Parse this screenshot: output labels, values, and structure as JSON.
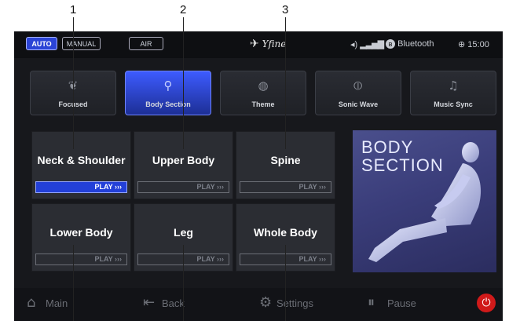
{
  "callouts": [
    "1",
    "2",
    "3"
  ],
  "topbar": {
    "modes": [
      {
        "label": "AUTO",
        "active": true
      },
      {
        "label": "MANUAL",
        "active": false
      },
      {
        "label": "AIR",
        "active": false
      }
    ],
    "logo": "Yfine",
    "bluetooth": "Bluetooth",
    "time": "15:00"
  },
  "tabs": [
    {
      "label": "Focused",
      "icon": "hands-icon",
      "active": false
    },
    {
      "label": "Body Section",
      "icon": "body-icon",
      "active": true
    },
    {
      "label": "Theme",
      "icon": "theme-icon",
      "active": false
    },
    {
      "label": "Sonic Wave",
      "icon": "wave-icon",
      "active": false
    },
    {
      "label": "Music Sync",
      "icon": "music-icon",
      "active": false
    }
  ],
  "sections": [
    {
      "title": "Neck & Shoulder",
      "play": "PLAY ›››",
      "active": true
    },
    {
      "title": "Upper Body",
      "play": "PLAY ›››",
      "active": false
    },
    {
      "title": "Spine",
      "play": "PLAY ›››",
      "active": false
    },
    {
      "title": "Lower Body",
      "play": "PLAY ›››",
      "active": false
    },
    {
      "title": "Leg",
      "play": "PLAY ›››",
      "active": false
    },
    {
      "title": "Whole Body",
      "play": "PLAY ›››",
      "active": false
    }
  ],
  "promo": {
    "line1": "BODY",
    "line2": "SECTION"
  },
  "bottom_nav": {
    "main": "Main",
    "back": "Back",
    "settings": "Settings",
    "pause": "Pause"
  },
  "colors": {
    "accent": "#2b44d6",
    "power": "#d01a1a",
    "screen_bg": "#17181c"
  }
}
